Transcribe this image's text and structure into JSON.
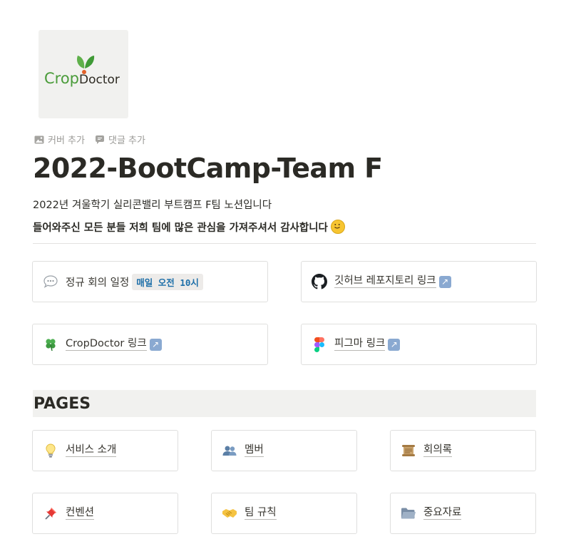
{
  "logo": {
    "word1": "Crop",
    "word2": "Doctor"
  },
  "page_actions": [
    {
      "icon": "image-icon",
      "label": "커버 추가"
    },
    {
      "icon": "comment-icon",
      "label": "댓글 추가"
    }
  ],
  "title": "2022-BootCamp-Team F",
  "description": {
    "line1": "2022년 겨울학기 실리콘밸리 부트캠프 F팀 노션입니다",
    "line2": "들어와주신 모든 분들 저희 팀에 많은 관심을 가져주셔서 감사합니다"
  },
  "link_cards": {
    "meeting": {
      "label": "정규 회의 일정",
      "badge": "매일 오전 10시"
    },
    "github": {
      "label": "깃허브 레포지토리 링크",
      "arrow": "↗"
    },
    "cropdoctor": {
      "label": "CropDoctor 링크",
      "arrow": "↗"
    },
    "figma": {
      "label": "피그마 링크",
      "arrow": "↗"
    }
  },
  "pages_section": {
    "title": "PAGES",
    "items": [
      {
        "icon": "lightbulb-icon",
        "label": "서비스 소개"
      },
      {
        "icon": "people-icon",
        "label": "멤버"
      },
      {
        "icon": "scroll-icon",
        "label": "회의록"
      },
      {
        "icon": "pushpin-icon",
        "label": "컨벤션"
      },
      {
        "icon": "handshake-icon",
        "label": "팀 규칙"
      },
      {
        "icon": "folder-icon",
        "label": "중요자료"
      }
    ]
  },
  "colors": {
    "text": "#37352f",
    "muted": "#9b9a97",
    "border": "#dfdfde",
    "section_bg": "#f1f1ef",
    "badge_text": "#1c6ea8",
    "brand_green": "#4a9c3a"
  }
}
